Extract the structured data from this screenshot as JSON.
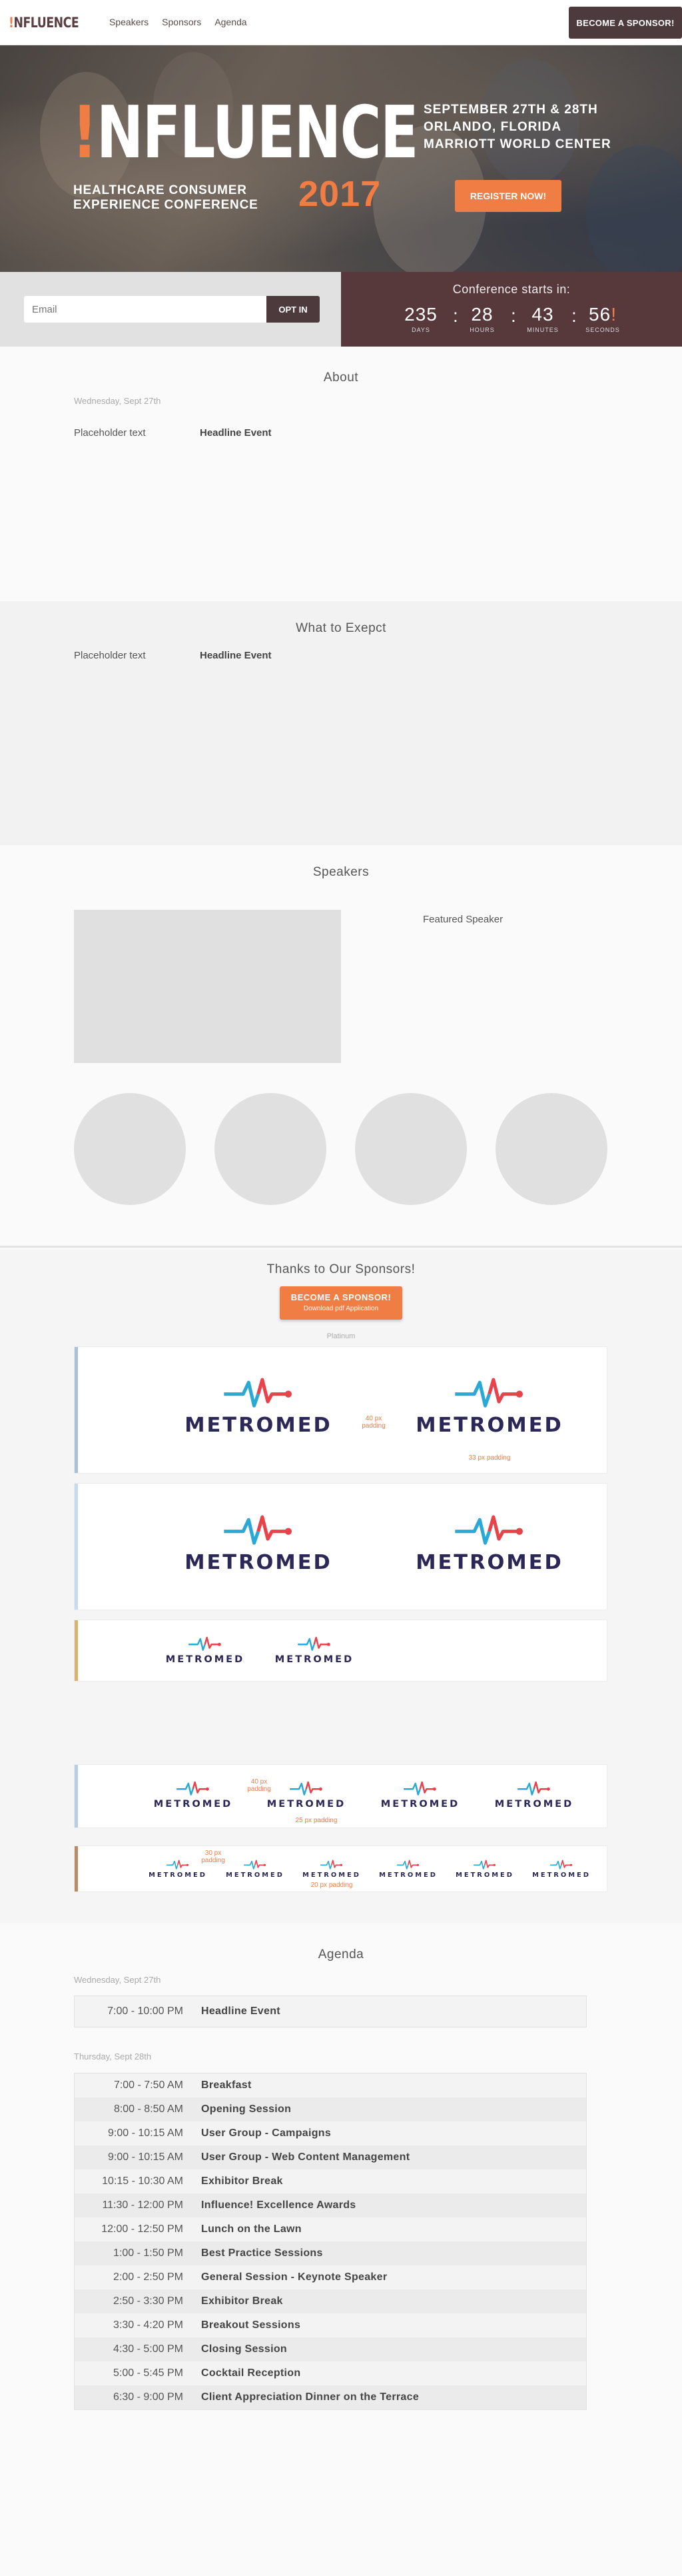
{
  "nav": {
    "logo_mark": "!",
    "logo_text": "NFLUENCE",
    "links": [
      "Speakers",
      "Sponsors",
      "Agenda"
    ],
    "cta": "BECOME A SPONSOR!"
  },
  "hero": {
    "title_mark": "!",
    "title_text": "NFLUENCE",
    "subtitle_line1": "HEALTHCARE CONSUMER",
    "subtitle_line2": "EXPERIENCE CONFERENCE",
    "year": "2017",
    "dates": "SEPTEMBER 27TH & 28TH",
    "city": "ORLANDO, FLORIDA",
    "venue": "MARRIOTT WORLD CENTER",
    "register": "REGISTER NOW!"
  },
  "optin": {
    "placeholder": "Email",
    "button": "OPT IN"
  },
  "countdown": {
    "title": "Conference starts in:",
    "units": [
      {
        "value": "235",
        "label": "DAYS"
      },
      {
        "value": "28",
        "label": "HOURS"
      },
      {
        "value": "43",
        "label": "MINUTES"
      },
      {
        "value": "56",
        "label": "SECONDS"
      }
    ],
    "separator": ":",
    "bang": "!"
  },
  "about": {
    "heading": "About",
    "date": "Wednesday, Sept 27th",
    "placeholder": "Placeholder text",
    "headline": "Headline Event"
  },
  "expect": {
    "heading": "What to Exepct",
    "placeholder": "Placeholder text",
    "headline": "Headline Event"
  },
  "speakers": {
    "heading": "Speakers",
    "featured": "Featured Speaker"
  },
  "sponsors": {
    "heading": "Thanks to Our Sponsors!",
    "button": "BECOME A SPONSOR!",
    "button_sub": "Download pdf Application",
    "tier_label": "Platinum",
    "logo_word": "METROMED",
    "padding_40": "40 px",
    "padding_40b": "padding",
    "padding_33": "33 px padding",
    "padding_40_v": "40 px",
    "padding_40_vb": "padding",
    "padding_25": "25 px padding",
    "padding_30": "30 px",
    "padding_30b": "padding",
    "padding_20": "20 px padding",
    "colors": {
      "brand_navy": "#2b2857",
      "pulse_blue": "#2aa9d6",
      "pulse_red": "#e8424a",
      "tier1_bar": "#a9c0d9",
      "tier2_bar": "#c7dbee",
      "tier3_bar": "#d9b273",
      "tier4_bar": "#b8cde4",
      "tier5_bar": "#b88a66"
    }
  },
  "agenda": {
    "heading": "Agenda",
    "day1_label": "Wednesday, Sept 27th",
    "day1": [
      {
        "time": "7:00 - 10:00 PM",
        "title": "Headline Event"
      }
    ],
    "day2_label": "Thursday, Sept 28th",
    "day2": [
      {
        "time": "7:00 - 7:50 AM",
        "title": "Breakfast"
      },
      {
        "time": "8:00 - 8:50 AM",
        "title": "Opening Session"
      },
      {
        "time": "9:00 - 10:15 AM",
        "title": "User Group - Campaigns"
      },
      {
        "time": "9:00 - 10:15 AM",
        "title": "User Group - Web Content Management"
      },
      {
        "time": "10:15 - 10:30 AM",
        "title": "Exhibitor Break"
      },
      {
        "time": "11:30 - 12:00 PM",
        "title": "Influence! Excellence Awards"
      },
      {
        "time": "12:00 - 12:50 PM",
        "title": "Lunch on the Lawn"
      },
      {
        "time": "1:00 - 1:50 PM",
        "title": "Best Practice Sessions"
      },
      {
        "time": "2:00 - 2:50 PM",
        "title": "General Session - Keynote Speaker"
      },
      {
        "time": "2:50 - 3:30 PM",
        "title": "Exhibitor Break"
      },
      {
        "time": "3:30 - 4:20 PM",
        "title": "Breakout Sessions"
      },
      {
        "time": "4:30 - 5:00 PM",
        "title": "Closing Session"
      },
      {
        "time": "5:00 - 5:45 PM",
        "title": "Cocktail Reception"
      },
      {
        "time": "6:30 - 9:00 PM",
        "title": "Client Appreciation Dinner on the Terrace"
      }
    ]
  },
  "accent": "#f07d43",
  "dark": "#4c3a3d"
}
